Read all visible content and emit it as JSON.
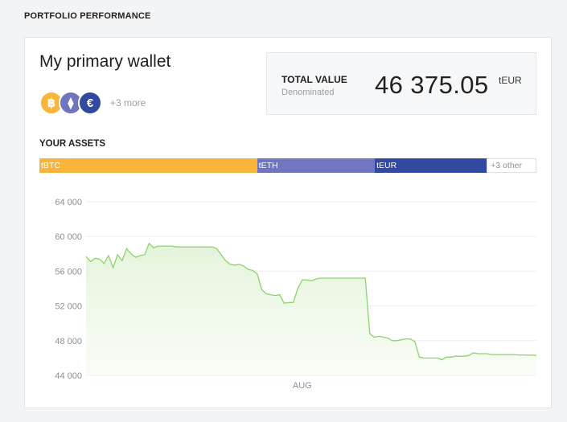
{
  "page": {
    "section_title": "PORTFOLIO PERFORMANCE"
  },
  "wallet": {
    "name": "My primary wallet",
    "coins": [
      {
        "name": "bitcoin-icon",
        "glyph": "฿",
        "color": "#f9b43c"
      },
      {
        "name": "ethereum-icon",
        "glyph": "⧫",
        "color": "#6f76bf"
      },
      {
        "name": "euro-icon",
        "glyph": "€",
        "color": "#314aa0"
      }
    ],
    "more_label": "+3 more"
  },
  "total": {
    "label": "TOTAL VALUE",
    "sublabel": "Denominated",
    "value": "46 375.05",
    "unit": "tEUR"
  },
  "assets": {
    "title": "YOUR ASSETS",
    "segments": [
      {
        "label": "tBTC",
        "share": 0.438,
        "color": "#f9b43c"
      },
      {
        "label": "tETH",
        "share": 0.237,
        "color": "#6f76bf"
      },
      {
        "label": "tEUR",
        "share": 0.225,
        "color": "#314aa0"
      },
      {
        "label": "+3 other",
        "share": 0.1,
        "color": "#ffffff"
      }
    ]
  },
  "chart_data": {
    "type": "area",
    "title": "",
    "xlabel": "",
    "ylabel": "",
    "ylim": [
      44000,
      64000
    ],
    "yticks": [
      44000,
      48000,
      52000,
      56000,
      60000,
      64000
    ],
    "ytick_labels": [
      "44 000",
      "48 000",
      "52 000",
      "56 000",
      "60 000",
      "64 000"
    ],
    "xtick_labels": [
      {
        "label": "AUG",
        "x": 48
      }
    ],
    "grid": true,
    "line_color": "#8cd36a",
    "fill_color": "#e8f5e0",
    "series": [
      {
        "x": [
          0,
          1,
          2,
          3,
          4,
          5,
          6,
          7,
          8,
          9,
          10,
          11,
          12,
          13,
          14,
          15,
          16,
          17,
          18,
          19,
          20,
          21,
          22,
          23,
          24,
          25,
          26,
          27,
          28,
          29,
          30,
          31,
          32,
          33,
          34,
          35,
          36,
          37,
          38,
          39,
          40,
          41,
          42,
          43,
          44,
          45,
          46,
          47,
          48,
          49,
          50,
          51,
          52,
          53,
          54,
          55,
          56,
          57,
          58,
          59,
          60,
          61,
          62,
          63,
          64,
          65,
          66,
          67,
          68,
          69,
          70,
          71,
          72,
          73,
          74,
          75,
          76,
          77,
          78,
          79,
          80,
          81,
          82,
          83,
          84,
          85,
          86,
          87,
          88,
          89,
          90,
          91,
          92,
          93,
          94,
          95,
          96,
          97,
          98,
          99,
          100
        ],
        "values": [
          57700,
          57100,
          57500,
          57400,
          56900,
          57800,
          56400,
          57900,
          57200,
          58600,
          58000,
          57600,
          57800,
          57900,
          59200,
          58700,
          58900,
          58900,
          58900,
          58900,
          58800,
          58800,
          58800,
          58800,
          58800,
          58800,
          58800,
          58800,
          58800,
          58600,
          57900,
          57200,
          56800,
          56700,
          56800,
          56600,
          56200,
          56100,
          55700,
          53900,
          53400,
          53300,
          53200,
          53300,
          52300,
          52400,
          52400,
          54000,
          55000,
          55000,
          54900,
          55100,
          55200,
          55200,
          55200,
          55200,
          55200,
          55200,
          55200,
          55200,
          55200,
          55200,
          55200,
          48800,
          48400,
          48500,
          48400,
          48300,
          48000,
          48000,
          48100,
          48200,
          48200,
          47900,
          46100,
          46000,
          46000,
          46000,
          46000,
          45800,
          46100,
          46100,
          46200,
          46200,
          46200,
          46300,
          46600,
          46500,
          46500,
          46500,
          46400,
          46400,
          46400,
          46400,
          46400,
          46400,
          46350,
          46350,
          46330,
          46320,
          46300
        ]
      }
    ]
  }
}
